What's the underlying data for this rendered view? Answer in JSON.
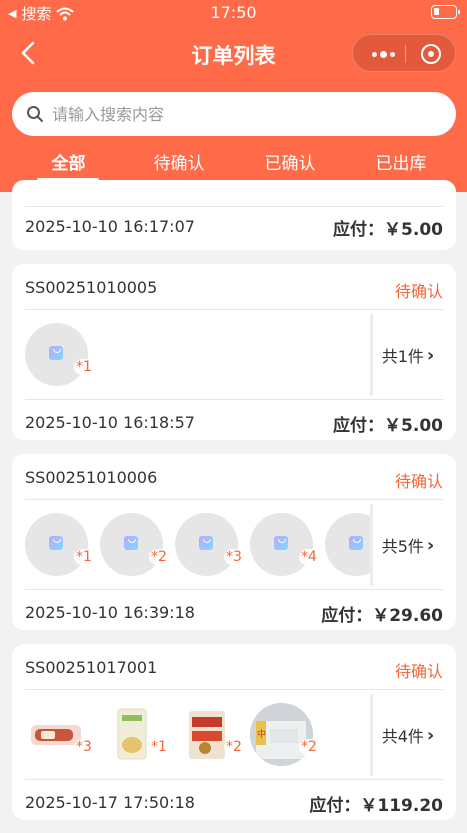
{
  "status_bar": {
    "carrier": "搜索",
    "time": "17:50"
  },
  "nav": {
    "title": "订单列表"
  },
  "search": {
    "placeholder": "请输入搜索内容"
  },
  "tabs": [
    {
      "label": "全部",
      "active": true
    },
    {
      "label": "待确认",
      "active": false
    },
    {
      "label": "已确认",
      "active": false
    },
    {
      "label": "已出库",
      "active": false
    }
  ],
  "orders": [
    {
      "date": "2025-10-10 16:17:07",
      "pay": "应付：￥5.00"
    },
    {
      "order_no": "SS00251010005",
      "status": "待确认",
      "items": [
        {
          "qty": "*1"
        }
      ],
      "count": "共1件",
      "date": "2025-10-10 16:18:57",
      "pay": "应付：￥5.00"
    },
    {
      "order_no": "SS00251010006",
      "status": "待确认",
      "items": [
        {
          "qty": "*1"
        },
        {
          "qty": "*2"
        },
        {
          "qty": "*3"
        },
        {
          "qty": "*4"
        },
        {
          "qty": ""
        }
      ],
      "count": "共5件",
      "date": "2025-10-10 16:39:18",
      "pay": "应付：￥29.60"
    },
    {
      "order_no": "SS00251017001",
      "status": "待确认",
      "items": [
        {
          "qty": "*3",
          "icon": "sausage-product-image"
        },
        {
          "qty": "*1",
          "icon": "flour-bag-product-image"
        },
        {
          "qty": "*2",
          "icon": "snack-bag-product-image"
        },
        {
          "qty": "*2",
          "icon": "rice-pack-product-image",
          "label": "中"
        }
      ],
      "count": "共4件",
      "date": "2025-10-17 17:50:18",
      "pay": "应付：￥119.20"
    }
  ],
  "colors": {
    "header": "#ff6a48",
    "status": "#f0683a",
    "page_bg": "#f2f2f2"
  }
}
